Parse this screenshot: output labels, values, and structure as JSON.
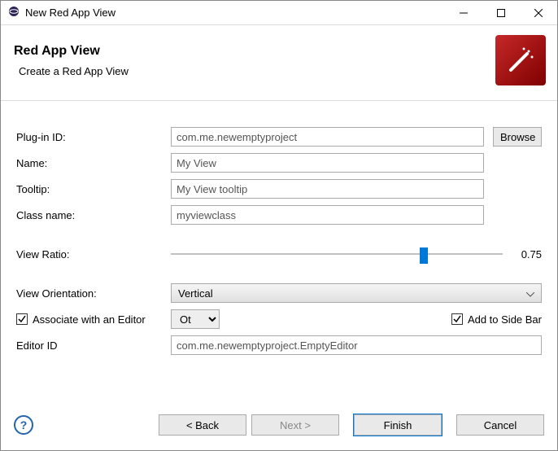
{
  "titlebar": {
    "text": "New Red App View"
  },
  "header": {
    "title": "Red App View",
    "subtitle": "Create a Red App View"
  },
  "labels": {
    "plugin": "Plug-in ID:",
    "name": "Name:",
    "tooltip": "Tooltip:",
    "classname": "Class name:",
    "viewratio": "View Ratio:",
    "orientation": "View Orientation:",
    "associate": "Associate with an Editor",
    "addside": "Add to Side Bar",
    "editorid": "Editor ID"
  },
  "values": {
    "plugin": "com.me.newemptyproject",
    "name": "My View",
    "tooltip": "My View tooltip",
    "classname": "myviewclass",
    "ratio": "0.75",
    "ratio_pct": 75,
    "orientation": "Vertical",
    "assoc_kind": "Other",
    "editorid": "com.me.newemptyproject.EmptyEditor",
    "assoc_checked": true,
    "addside_checked": true
  },
  "buttons": {
    "browse": "Browse",
    "back": "< Back",
    "next": "Next >",
    "finish": "Finish",
    "cancel": "Cancel"
  }
}
